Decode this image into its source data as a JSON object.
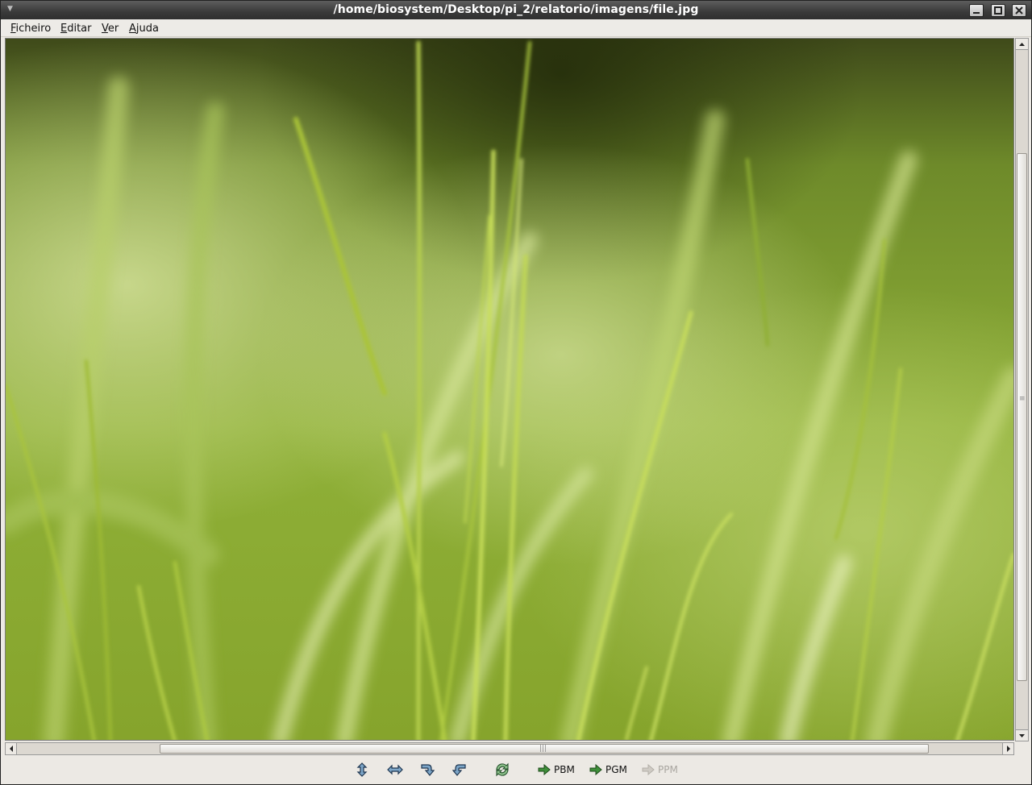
{
  "window": {
    "title": "/home/biosystem/Desktop/pi_2/relatorio/imagens/file.jpg",
    "buttons": [
      "minimize",
      "maximize",
      "close"
    ]
  },
  "menubar": {
    "items": [
      {
        "first": "F",
        "rest": "icheiro"
      },
      {
        "first": "E",
        "rest": "ditar"
      },
      {
        "first": "V",
        "rest": "er"
      },
      {
        "first": "A",
        "rest": "juda"
      }
    ]
  },
  "viewer": {
    "image_subject": "green grass blades close-up",
    "colors": {
      "dark": "#2f3a12",
      "mid": "#7fa22a",
      "light": "#c8dd6a",
      "highlight": "#e9f2a8"
    }
  },
  "toolbar": {
    "icons": [
      "flip-vertical-icon",
      "flip-horizontal-icon",
      "rotate-clockwise-icon",
      "rotate-counterclockwise-icon",
      "refresh-icon"
    ],
    "convert": {
      "pbm": "PBM",
      "pgm": "PGM",
      "ppm": "PPM"
    }
  }
}
